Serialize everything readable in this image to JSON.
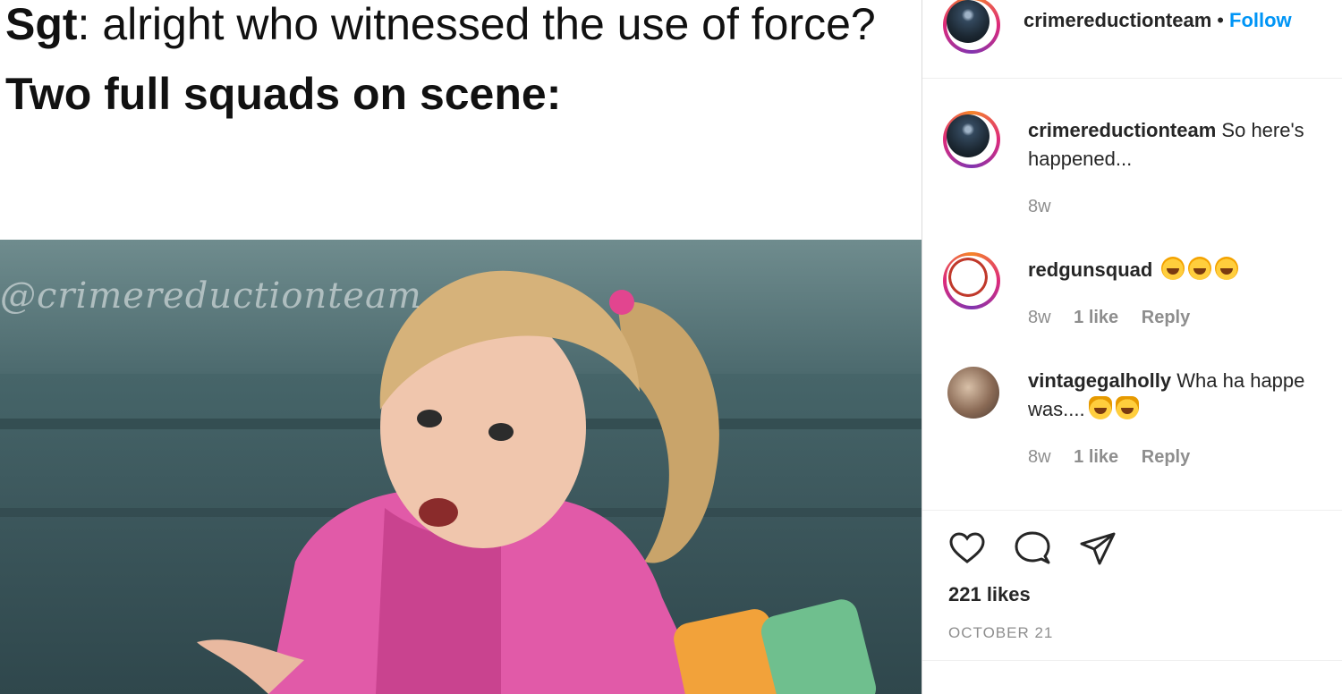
{
  "meme": {
    "line1_speaker": "Sgt",
    "line1_rest": ": alright who witnessed the use of force?",
    "line2": "Two full squads on scene:",
    "watermark": "@crimereductionteam"
  },
  "header": {
    "username": "crimereductionteam",
    "separator": "•",
    "follow_label": "Follow"
  },
  "comments": [
    {
      "username": "crimereductionteam",
      "text_line1": "So here's",
      "text_line2": "happened...",
      "time": "8w"
    },
    {
      "username": "redgunsquad",
      "emoji": [
        "face-with-tears-of-joy",
        "face-with-tears-of-joy",
        "face-with-tears-of-joy"
      ],
      "time": "8w",
      "likes": "1 like",
      "reply": "Reply"
    },
    {
      "username": "vintagegalholly",
      "text_line1": "Wha ha happe",
      "text_line2": "was....",
      "emoji": [
        "cat-with-tears-of-joy",
        "cat-with-tears-of-joy"
      ],
      "time": "8w",
      "likes": "1 like",
      "reply": "Reply"
    }
  ],
  "actions": {
    "like_icon": "heart-icon",
    "comment_icon": "comment-icon",
    "share_icon": "paper-plane-icon"
  },
  "likes": "221 likes",
  "date": "OCTOBER 21",
  "colors": {
    "follow": "#0095f6",
    "meta": "#8e8e8e",
    "text": "#262626"
  }
}
